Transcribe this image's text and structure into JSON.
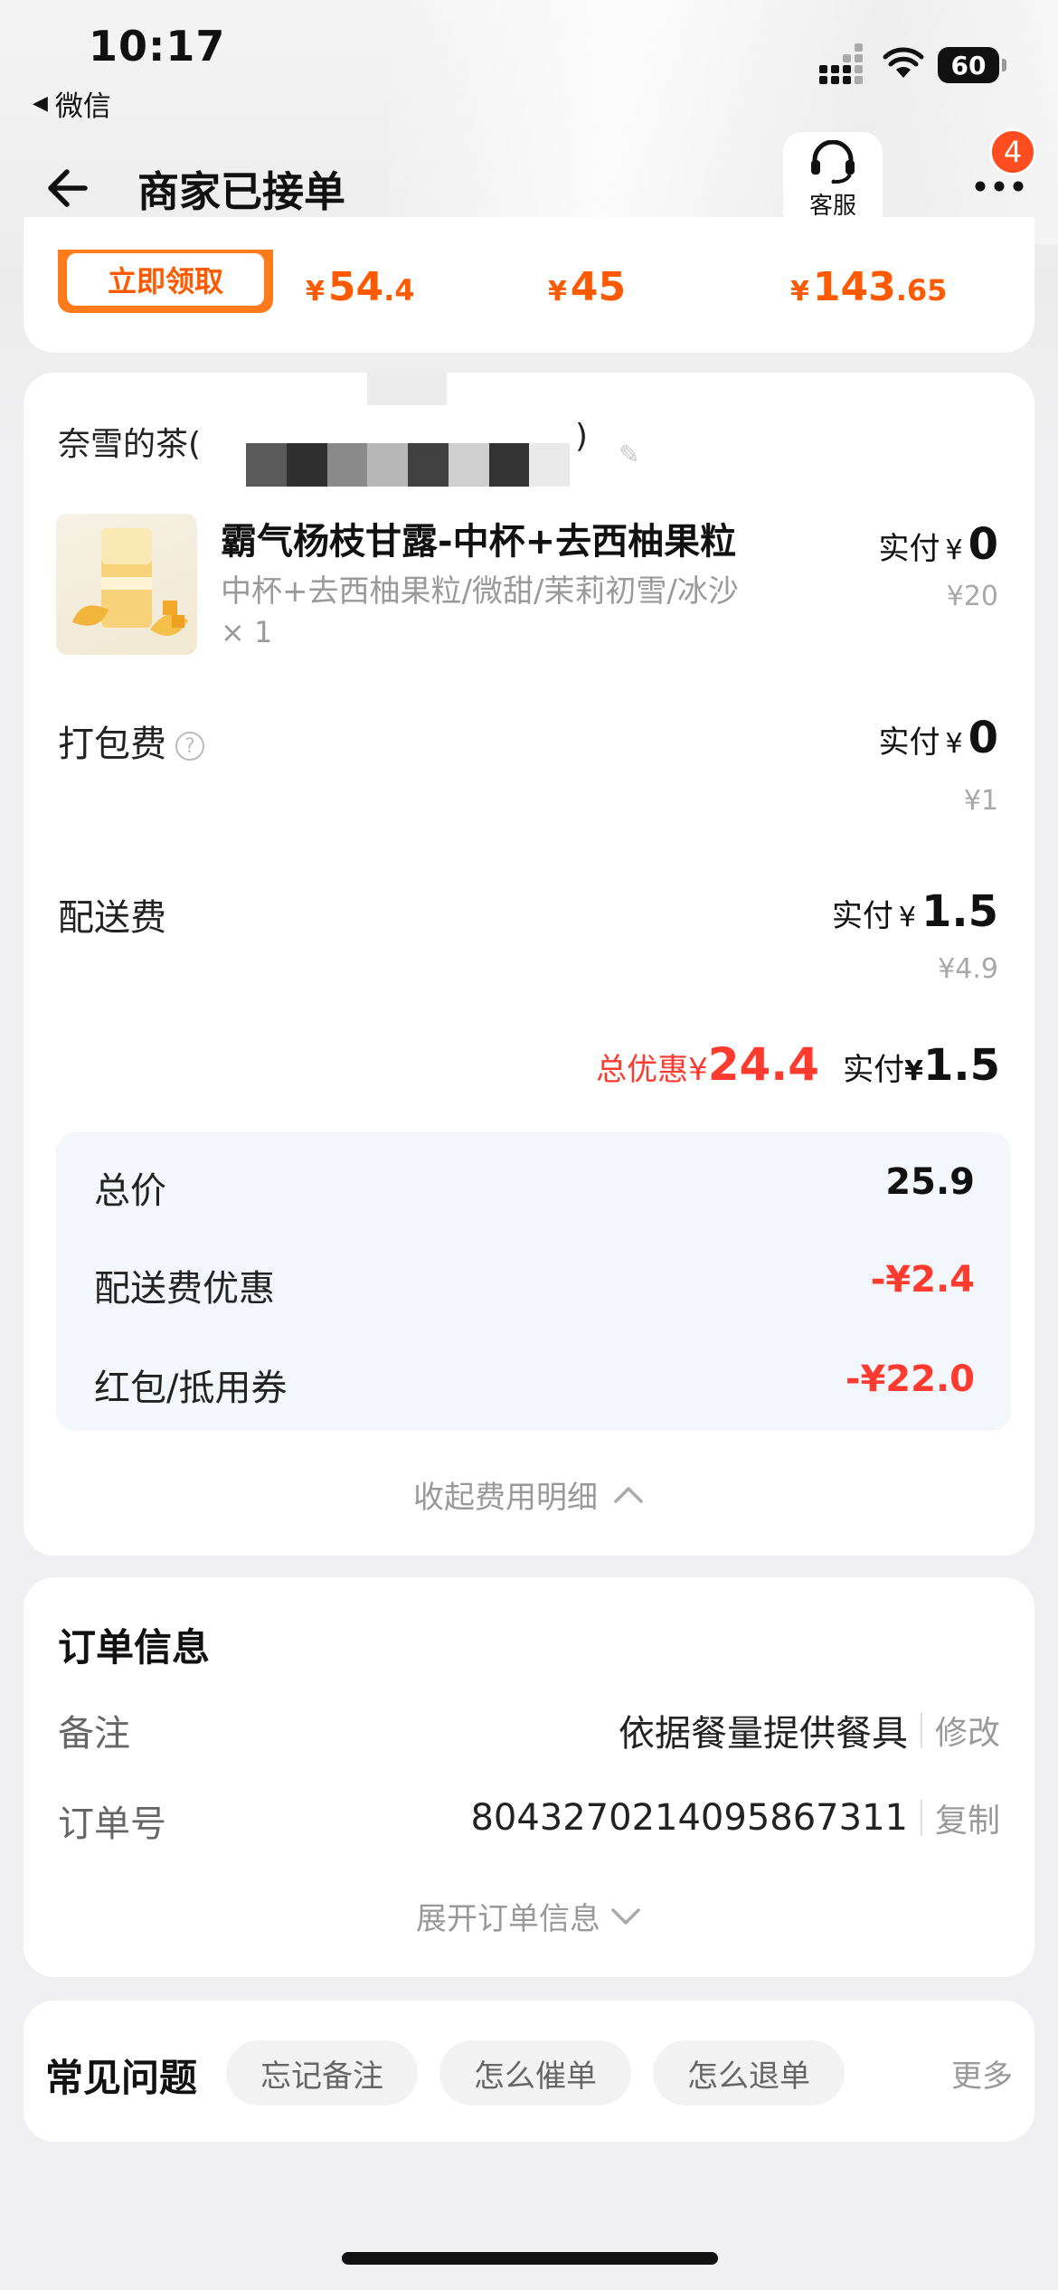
{
  "status_bar": {
    "time": "10:17",
    "back_app": "微信",
    "battery": "60"
  },
  "nav": {
    "title": "商家已接单",
    "service_label": "客服",
    "badge_count": "4"
  },
  "promo": {
    "claim_label": "立即领取",
    "prices": [
      {
        "yen": "¥",
        "int": "54",
        "dec": ".4"
      },
      {
        "yen": "¥",
        "int": "45",
        "dec": ""
      },
      {
        "yen": "¥",
        "int": "143",
        "dec": ".65"
      }
    ]
  },
  "order": {
    "store_name": "奈雪的茶(",
    "store_name_tail": ")",
    "product": {
      "title": "霸气杨枝甘露-中杯+去西柚果粒",
      "spec": "中杯+去西柚果粒/微甜/茉莉初雪/冰沙",
      "qty": "× 1",
      "paid_label": "实付",
      "paid_currency": "¥",
      "paid_value": "0",
      "original_price": "¥20"
    },
    "packing": {
      "label": "打包费",
      "help_icon": "?",
      "paid_label": "实付",
      "paid_currency": "¥",
      "paid_value": "0",
      "original_price": "¥1"
    },
    "delivery": {
      "label": "配送费",
      "paid_label": "实付",
      "paid_currency": "¥",
      "paid_value": "1.5",
      "original_price": "¥4.9"
    },
    "summary": {
      "discount_label": "总优惠¥",
      "discount_value": "24.4",
      "paid_label": "实付",
      "paid_currency": "¥",
      "paid_value": "1.5"
    },
    "breakdown": [
      {
        "label": "总价",
        "value": "25.9"
      },
      {
        "label": "配送费优惠",
        "value": "-¥2.4"
      },
      {
        "label": "红包/抵用券",
        "value": "-¥22.0"
      }
    ],
    "collapse_label": "收起费用明细"
  },
  "order_info": {
    "title": "订单信息",
    "remark_label": "备注",
    "remark_value": "依据餐量提供餐具",
    "remark_action": "修改",
    "order_no_label": "订单号",
    "order_no_value": "8043270214095867311",
    "order_no_action": "复制",
    "expand_label": "展开订单信息"
  },
  "faq": {
    "title": "常见问题",
    "chips": [
      "忘记备注",
      "怎么催单",
      "怎么退单"
    ],
    "more": "更多"
  },
  "colors": {
    "accent_orange": "#ff5a00",
    "discount_red": "#ff3b30"
  }
}
